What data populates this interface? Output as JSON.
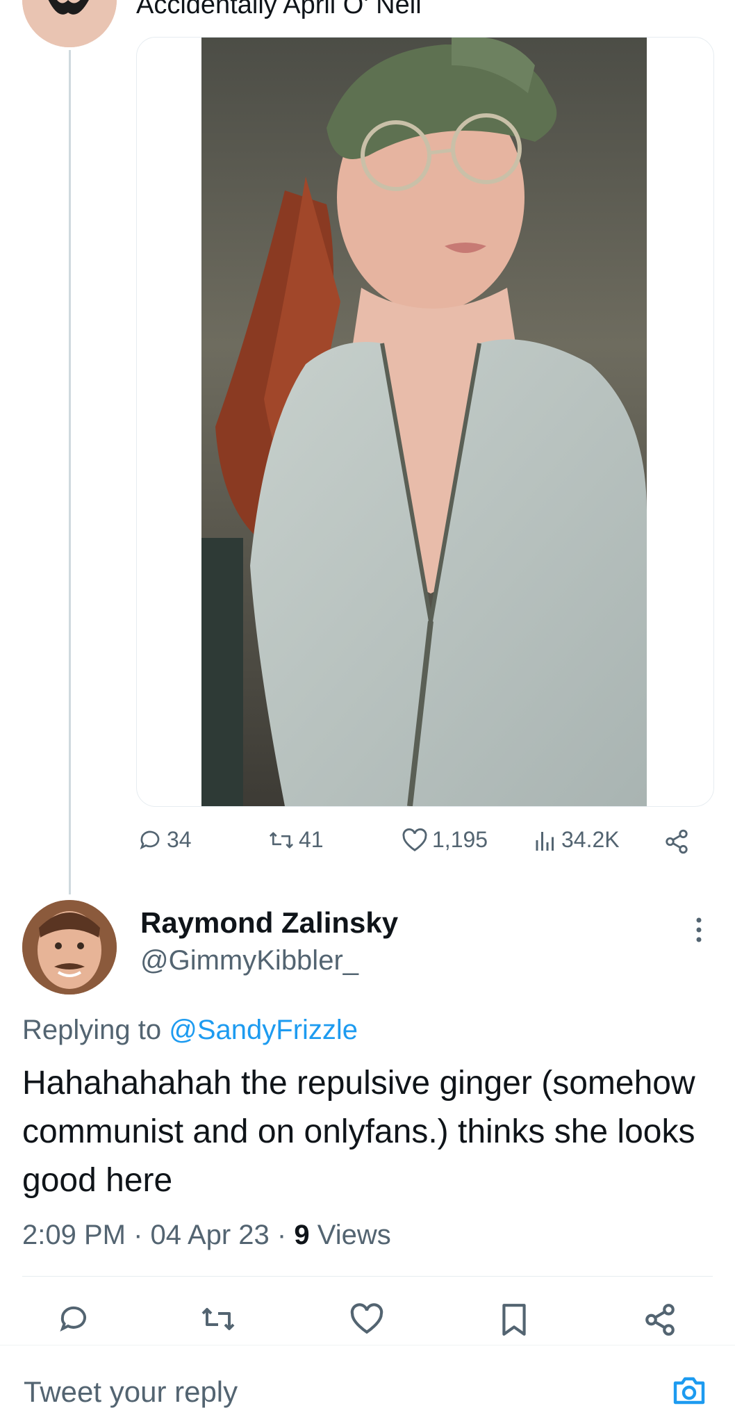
{
  "original_tweet": {
    "author_name": "Accidentally April O' Neil",
    "stats": {
      "replies": "34",
      "retweets": "41",
      "likes": "1,195",
      "views": "34.2K"
    }
  },
  "reply_tweet": {
    "author_name": "Raymond Zalinsky",
    "handle": "@GimmyKibbler_",
    "replying_prefix": "Replying to",
    "replying_to": "@SandyFrizzle",
    "text": "Hahahahahah the repulsive ginger (somehow communist and on onlyfans.) thinks she looks good here",
    "time": "2:09 PM",
    "separator": "·",
    "date": "04 Apr 23",
    "views_count": "9",
    "views_label": "Views"
  },
  "composer": {
    "placeholder": "Tweet your reply"
  },
  "colors": {
    "accent": "#1d9bf0",
    "secondary_text": "#536471",
    "primary_text": "#0f1419",
    "divider": "#e6ecf0"
  },
  "icons": [
    "reply-icon",
    "retweet-icon",
    "like-icon",
    "views-icon",
    "share-icon",
    "bookmark-icon",
    "more-icon",
    "camera-icon"
  ]
}
